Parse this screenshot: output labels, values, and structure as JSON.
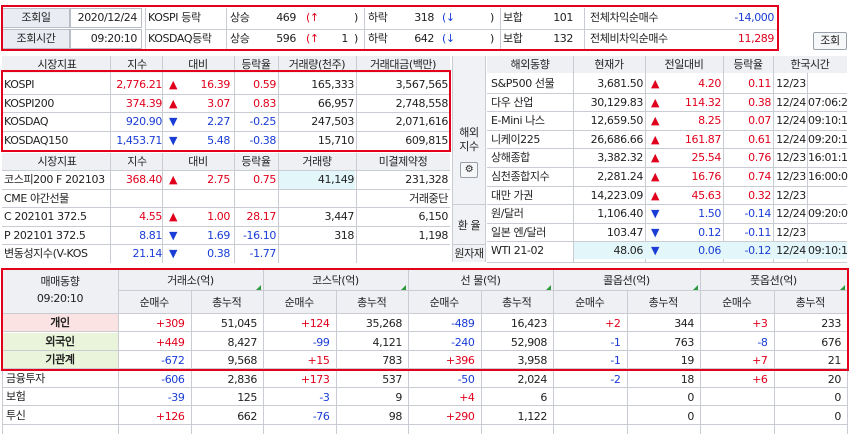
{
  "top": {
    "date_label": "조회일",
    "date_value": "2020/12/24",
    "time_label": "조회시간",
    "time_value": "09:20:10",
    "kospi": {
      "name": "KOSPI 등락",
      "up_label": "상승",
      "up": "469",
      "up_arrow": "(↑",
      "up_paren": ")",
      "down_label": "하락",
      "down": "318",
      "down_arrow": "(↓",
      "down_paren": ")",
      "flat_label": "보합",
      "flat": "101",
      "net_label": "전체차익순매수",
      "net": "-14,000"
    },
    "kosdaq": {
      "name": "KOSDAQ등락",
      "up_label": "상승",
      "up": "596",
      "up_arrow": "(↑",
      "up_count": "1",
      "up_paren": ")",
      "down_label": "하락",
      "down": "642",
      "down_arrow": "(↓",
      "down_paren": ")",
      "flat_label": "보합",
      "flat": "132",
      "net_label": "전체비차익순매수",
      "net": "11,289"
    },
    "query_button": "조회"
  },
  "index_table": {
    "headers": [
      "시장지표",
      "지수",
      "대비",
      "등락율",
      "거래량(천주)",
      "거래대금(백만)"
    ],
    "rows": [
      {
        "name": "KOSPI",
        "value": "2,776.21",
        "arrow": "▲",
        "change": "16.39",
        "rate": "0.59",
        "volume": "165,333",
        "amount": "3,567,565",
        "dir": "up"
      },
      {
        "name": "KOSPI200",
        "value": "374.39",
        "arrow": "▲",
        "change": "3.07",
        "rate": "0.83",
        "volume": "66,957",
        "amount": "2,748,558",
        "dir": "up"
      },
      {
        "name": "KOSDAQ",
        "value": "920.90",
        "arrow": "▼",
        "change": "2.27",
        "rate": "-0.25",
        "volume": "247,503",
        "amount": "2,071,616",
        "dir": "down"
      },
      {
        "name": "KOSDAQ150",
        "value": "1,453.71",
        "arrow": "▼",
        "change": "5.48",
        "rate": "-0.38",
        "volume": "15,710",
        "amount": "609,815",
        "dir": "down"
      }
    ]
  },
  "futures_table": {
    "headers": [
      "시장지표",
      "지수",
      "대비",
      "등락율",
      "거래량",
      "미결제약정"
    ],
    "rows": [
      {
        "name": "코스피200 F 202103",
        "value": "368.40",
        "arrow": "▲",
        "change": "2.75",
        "rate": "0.75",
        "volume": "41,149",
        "oi": "231,328",
        "dir": "up"
      },
      {
        "name": "CME 야간선물",
        "value": "",
        "arrow": "",
        "change": "",
        "rate": "",
        "volume": "",
        "oi": "거래중단",
        "dir": "flat"
      },
      {
        "name": "C 202101 372.5",
        "value": "4.55",
        "arrow": "▲",
        "change": "1.00",
        "rate": "28.17",
        "volume": "3,447",
        "oi": "6,150",
        "dir": "up"
      },
      {
        "name": "P 202101 372.5",
        "value": "8.81",
        "arrow": "▼",
        "change": "1.69",
        "rate": "-16.10",
        "volume": "318",
        "oi": "1,198",
        "dir": "down"
      },
      {
        "name": "변동성지수(V-KOS",
        "value": "21.14",
        "arrow": "▼",
        "change": "0.38",
        "rate": "-1.77",
        "volume": "",
        "oi": "",
        "dir": "down"
      }
    ]
  },
  "side_labels": {
    "overseas": "해외\n지수",
    "fx": "환 율",
    "commodity": "원자재"
  },
  "overseas_table": {
    "headers": [
      "해외동향",
      "현재가",
      "전일대비",
      "등락율",
      "한국시간"
    ],
    "rows": [
      {
        "name": "S&P500 선물",
        "price": "3,681.50",
        "arrow": "▲",
        "change": "4.20",
        "rate": "0.11",
        "date": "12/23",
        "time": "",
        "dir": "up"
      },
      {
        "name": "다우 산업",
        "price": "30,129.83",
        "arrow": "▲",
        "change": "114.32",
        "rate": "0.38",
        "date": "12/24",
        "time": "07:06:28",
        "dir": "up"
      },
      {
        "name": "E-Mini 나스",
        "price": "12,659.50",
        "arrow": "▲",
        "change": "8.25",
        "rate": "0.07",
        "date": "12/24",
        "time": "09:10:15",
        "dir": "up"
      },
      {
        "name": "니케이225",
        "price": "26,686.66",
        "arrow": "▲",
        "change": "161.87",
        "rate": "0.61",
        "date": "12/24",
        "time": "09:20:15",
        "dir": "up"
      },
      {
        "name": "상해종합",
        "price": "3,382.32",
        "arrow": "▲",
        "change": "25.54",
        "rate": "0.76",
        "date": "12/23",
        "time": "16:01:12",
        "dir": "up"
      },
      {
        "name": "심천종합지수",
        "price": "2,281.24",
        "arrow": "▲",
        "change": "16.76",
        "rate": "0.74",
        "date": "12/23",
        "time": "16:00:03",
        "dir": "up"
      },
      {
        "name": "대만 가권",
        "price": "14,223.09",
        "arrow": "▲",
        "change": "45.63",
        "rate": "0.32",
        "date": "12/23",
        "time": "",
        "dir": "up"
      },
      {
        "name": "원/달러",
        "price": "1,106.40",
        "arrow": "▼",
        "change": "1.50",
        "rate": "-0.14",
        "date": "12/24",
        "time": "09:20:08",
        "dir": "down"
      },
      {
        "name": "일본 엔/달러",
        "price": "103.47",
        "arrow": "▼",
        "change": "0.12",
        "rate": "-0.11",
        "date": "12/23",
        "time": "",
        "dir": "down"
      },
      {
        "name": "WTI 21-02",
        "price": "48.06",
        "arrow": "▼",
        "change": "0.06",
        "rate": "-0.12",
        "date": "12/24",
        "time": "09:10:16",
        "dir": "down"
      }
    ]
  },
  "investor_table": {
    "title": "매매동향",
    "time": "09:20:10",
    "groups": [
      "거래소(억)",
      "코스닥(억)",
      "선  물(억)",
      "콜옵션(억)",
      "풋옵션(억)"
    ],
    "subheaders": [
      "순매수",
      "총누적"
    ],
    "rows": [
      {
        "name": "개인",
        "values": [
          "+309",
          "51,045",
          "+124",
          "35,268",
          "-489",
          "16,423",
          "+2",
          "344",
          "+3",
          "233"
        ]
      },
      {
        "name": "외국인",
        "values": [
          "+449",
          "8,427",
          "-99",
          "4,121",
          "-240",
          "52,908",
          "-1",
          "763",
          "-8",
          "676"
        ]
      },
      {
        "name": "기관계",
        "values": [
          "-672",
          "9,568",
          "+15",
          "783",
          "+396",
          "3,958",
          "-1",
          "19",
          "+7",
          "21"
        ]
      },
      {
        "name": "금융투자",
        "values": [
          "-606",
          "2,836",
          "+173",
          "537",
          "-50",
          "2,024",
          "-2",
          "18",
          "+6",
          "20"
        ]
      },
      {
        "name": "보험",
        "values": [
          "-39",
          "125",
          "-3",
          "9",
          "+4",
          "6",
          "",
          "0",
          "",
          "0"
        ]
      },
      {
        "name": "투신",
        "values": [
          "+126",
          "662",
          "-76",
          "98",
          "+290",
          "1,122",
          "",
          "0",
          "",
          "0"
        ]
      }
    ]
  },
  "colors": {
    "up": "#e0001b",
    "down": "#1a3dd6",
    "highlight_box": "#e2001a",
    "header_bg": "#eef0f4"
  }
}
